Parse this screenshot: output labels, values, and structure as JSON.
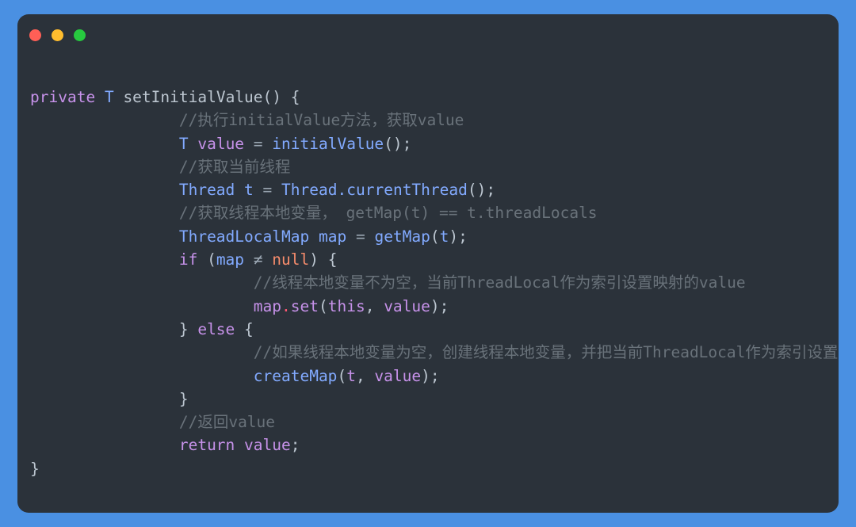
{
  "window": {
    "background_color": "#4a90e2",
    "card_color": "#2b323a",
    "traffic_lights": [
      {
        "name": "close",
        "color": "#ff5f56"
      },
      {
        "name": "minimize",
        "color": "#ffbd2e"
      },
      {
        "name": "maximize",
        "color": "#27c93f"
      }
    ]
  },
  "theme": {
    "keyword": "#c792ea",
    "type": "#82aaff",
    "function": "#82aaff",
    "variable": "#c792ea",
    "literal": "#f78c6c",
    "punctuation": "#bcc6d0",
    "operator": "#9aa6b2",
    "member_dot": "#ff5874",
    "comment": "#69727a",
    "foreground": "#c3cbd4"
  },
  "code": {
    "language": "java",
    "lines": [
      {
        "indent": 0,
        "tokens": [
          {
            "t": "private",
            "c": "kw"
          },
          {
            "t": " ",
            "c": "pun"
          },
          {
            "t": "T",
            "c": "typ"
          },
          {
            "t": " ",
            "c": "pun"
          },
          {
            "t": "setInitialValue",
            "c": "pun"
          },
          {
            "t": "() {",
            "c": "pun"
          }
        ]
      },
      {
        "indent": 2,
        "tokens": [
          {
            "t": "//执行initialValue方法，获取value",
            "c": "cmt"
          }
        ]
      },
      {
        "indent": 2,
        "tokens": [
          {
            "t": "T",
            "c": "typ"
          },
          {
            "t": " ",
            "c": "pun"
          },
          {
            "t": "value",
            "c": "var"
          },
          {
            "t": " ",
            "c": "pun"
          },
          {
            "t": "=",
            "c": "op"
          },
          {
            "t": " ",
            "c": "pun"
          },
          {
            "t": "initialValue",
            "c": "fn"
          },
          {
            "t": "();",
            "c": "pun"
          }
        ]
      },
      {
        "indent": 2,
        "tokens": [
          {
            "t": "//获取当前线程",
            "c": "cmt"
          }
        ]
      },
      {
        "indent": 2,
        "tokens": [
          {
            "t": "Thread",
            "c": "typ"
          },
          {
            "t": " ",
            "c": "pun"
          },
          {
            "t": "t",
            "c": "typ"
          },
          {
            "t": " ",
            "c": "pun"
          },
          {
            "t": "=",
            "c": "op"
          },
          {
            "t": " ",
            "c": "pun"
          },
          {
            "t": "Thread",
            "c": "typ"
          },
          {
            "t": ".",
            "c": "typ"
          },
          {
            "t": "currentThread",
            "c": "typ"
          },
          {
            "t": "();",
            "c": "pun"
          }
        ]
      },
      {
        "indent": 2,
        "tokens": [
          {
            "t": "//获取线程本地变量， getMap(t) == t.threadLocals",
            "c": "cmt"
          }
        ]
      },
      {
        "indent": 2,
        "tokens": [
          {
            "t": "ThreadLocalMap",
            "c": "typ"
          },
          {
            "t": " ",
            "c": "pun"
          },
          {
            "t": "map",
            "c": "typ"
          },
          {
            "t": " ",
            "c": "pun"
          },
          {
            "t": "=",
            "c": "op"
          },
          {
            "t": " ",
            "c": "pun"
          },
          {
            "t": "getMap",
            "c": "typ"
          },
          {
            "t": "(",
            "c": "pun"
          },
          {
            "t": "t",
            "c": "typ"
          },
          {
            "t": ");",
            "c": "pun"
          }
        ]
      },
      {
        "indent": 2,
        "tokens": [
          {
            "t": "if",
            "c": "kw"
          },
          {
            "t": " (",
            "c": "pun"
          },
          {
            "t": "map",
            "c": "typ"
          },
          {
            "t": " ",
            "c": "pun"
          },
          {
            "t": "≠",
            "c": "op"
          },
          {
            "t": " ",
            "c": "pun"
          },
          {
            "t": "null",
            "c": "lit"
          },
          {
            "t": ") {",
            "c": "pun"
          }
        ]
      },
      {
        "indent": 3,
        "tokens": [
          {
            "t": "//线程本地变量不为空，当前ThreadLocal作为索引设置映射的value",
            "c": "cmt"
          }
        ]
      },
      {
        "indent": 3,
        "tokens": [
          {
            "t": "map",
            "c": "var"
          },
          {
            "t": ".",
            "c": "dot2"
          },
          {
            "t": "set",
            "c": "var"
          },
          {
            "t": "(",
            "c": "pun"
          },
          {
            "t": "this",
            "c": "kw"
          },
          {
            "t": ", ",
            "c": "pun"
          },
          {
            "t": "value",
            "c": "var"
          },
          {
            "t": ");",
            "c": "pun"
          }
        ]
      },
      {
        "indent": 2,
        "tokens": [
          {
            "t": "} ",
            "c": "pun"
          },
          {
            "t": "else",
            "c": "kw"
          },
          {
            "t": " {",
            "c": "pun"
          }
        ]
      },
      {
        "indent": 3,
        "tokens": [
          {
            "t": "//如果线程本地变量为空，创建线程本地变量，并把当前ThreadLocal作为索引设置映射的value",
            "c": "cmt"
          }
        ]
      },
      {
        "indent": 3,
        "tokens": [
          {
            "t": "createMap",
            "c": "typ"
          },
          {
            "t": "(",
            "c": "pun"
          },
          {
            "t": "t",
            "c": "var"
          },
          {
            "t": ", ",
            "c": "pun"
          },
          {
            "t": "value",
            "c": "var"
          },
          {
            "t": ");",
            "c": "pun"
          }
        ]
      },
      {
        "indent": 2,
        "tokens": [
          {
            "t": "}",
            "c": "pun"
          }
        ]
      },
      {
        "indent": 2,
        "tokens": [
          {
            "t": "//返回value",
            "c": "cmt"
          }
        ]
      },
      {
        "indent": 2,
        "tokens": [
          {
            "t": "return",
            "c": "kw"
          },
          {
            "t": " ",
            "c": "pun"
          },
          {
            "t": "value",
            "c": "var"
          },
          {
            "t": ";",
            "c": "pun"
          }
        ]
      },
      {
        "indent": 0,
        "tokens": [
          {
            "t": "}",
            "c": "pun"
          }
        ]
      }
    ]
  }
}
